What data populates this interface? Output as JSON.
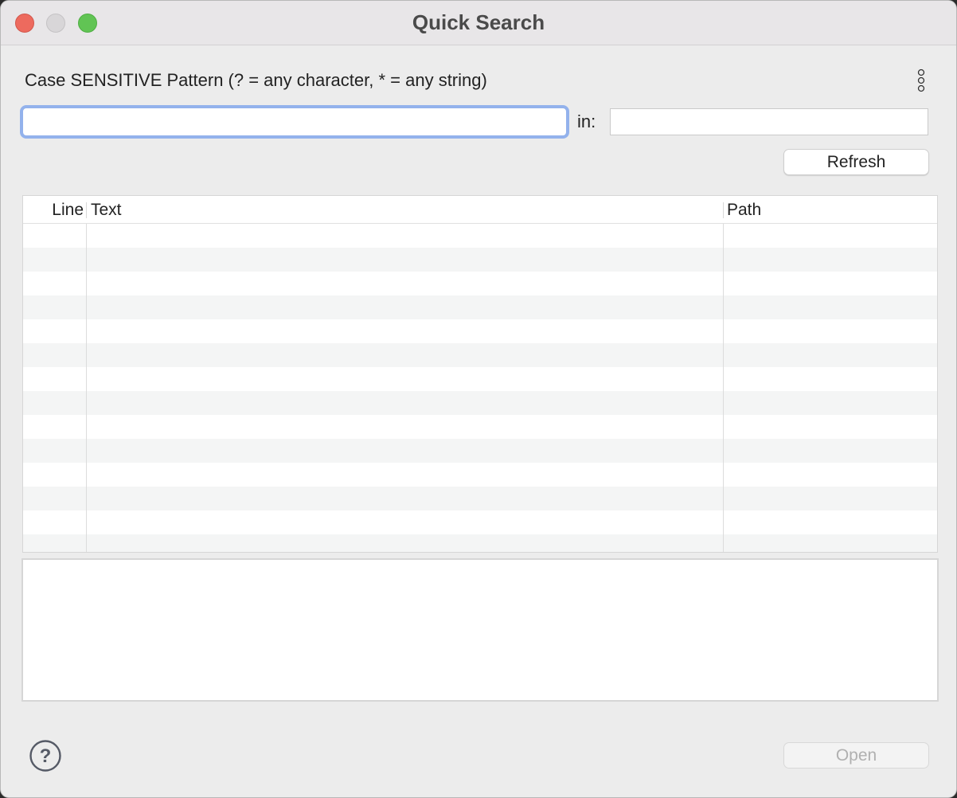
{
  "window": {
    "title": "Quick Search"
  },
  "search": {
    "pattern_label": "Case SENSITIVE Pattern (? = any character, * = any string)",
    "pattern_value": "",
    "in_label": "in:",
    "in_value": "",
    "refresh_label": "Refresh"
  },
  "results": {
    "columns": [
      "Line",
      "Text",
      "Path"
    ],
    "rows": []
  },
  "footer": {
    "open_label": "Open"
  },
  "icons": {
    "menu": "vertical-ellipsis-icon",
    "help": "question-mark-icon"
  },
  "colors": {
    "focus_ring": "#93b2ec",
    "close": "#ed6a5e",
    "minimize": "#d8d6d8",
    "zoom": "#61c454"
  }
}
